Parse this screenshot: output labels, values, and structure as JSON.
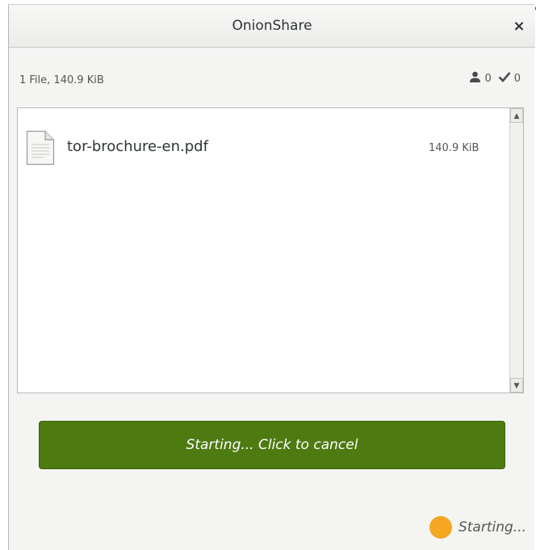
{
  "window": {
    "title": "OnionShare",
    "close_icon": "×"
  },
  "info": {
    "file_summary": "1 File, 140.9 KiB",
    "downloads_count": "0",
    "completed_count": "0",
    "downloads_icon": "person-icon",
    "completed_icon": "checkmark-icon"
  },
  "files": [
    {
      "name": "tor-brochure-en.pdf",
      "size": "140.9 KiB",
      "icon": "document-icon"
    }
  ],
  "scrollbar": {
    "up_glyph": "▲",
    "down_glyph": "▼"
  },
  "action": {
    "button_label": "Starting... Click to cancel",
    "button_color": "#4e7a12"
  },
  "status": {
    "text": "Starting...",
    "indicator_color": "#f5a623"
  }
}
